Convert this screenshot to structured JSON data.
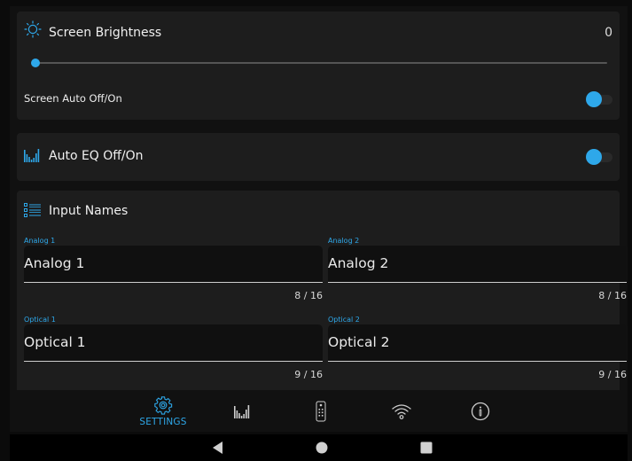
{
  "brightness": {
    "title": "Screen Brightness",
    "value_text": "0",
    "slider_level": 0
  },
  "auto_off": {
    "label": "Screen Auto Off/On",
    "enabled": true
  },
  "auto_eq": {
    "title": "Auto EQ Off/On",
    "enabled": true
  },
  "inputs": {
    "title": "Input Names",
    "fields": [
      {
        "caption": "Analog 1",
        "value": "Analog 1",
        "counter": "8 / 16"
      },
      {
        "caption": "Analog 2",
        "value": "Analog 2",
        "counter": "8 / 16"
      },
      {
        "caption": "Optical 1",
        "value": "Optical 1",
        "counter": "9 / 16"
      },
      {
        "caption": "Optical 2",
        "value": "Optical 2",
        "counter": "9 / 16"
      }
    ]
  },
  "nav": {
    "active": "settings",
    "settings_label": "SETTINGS",
    "icons": [
      "gear-icon",
      "equalizer-icon",
      "remote-icon",
      "wifi-icon",
      "info-icon"
    ]
  },
  "system_bar": {
    "icons": [
      "back-icon",
      "home-icon",
      "recents-icon"
    ]
  },
  "colors": {
    "accent": "#2ea8ea",
    "card": "#1d1d1d",
    "background": "#111111"
  }
}
